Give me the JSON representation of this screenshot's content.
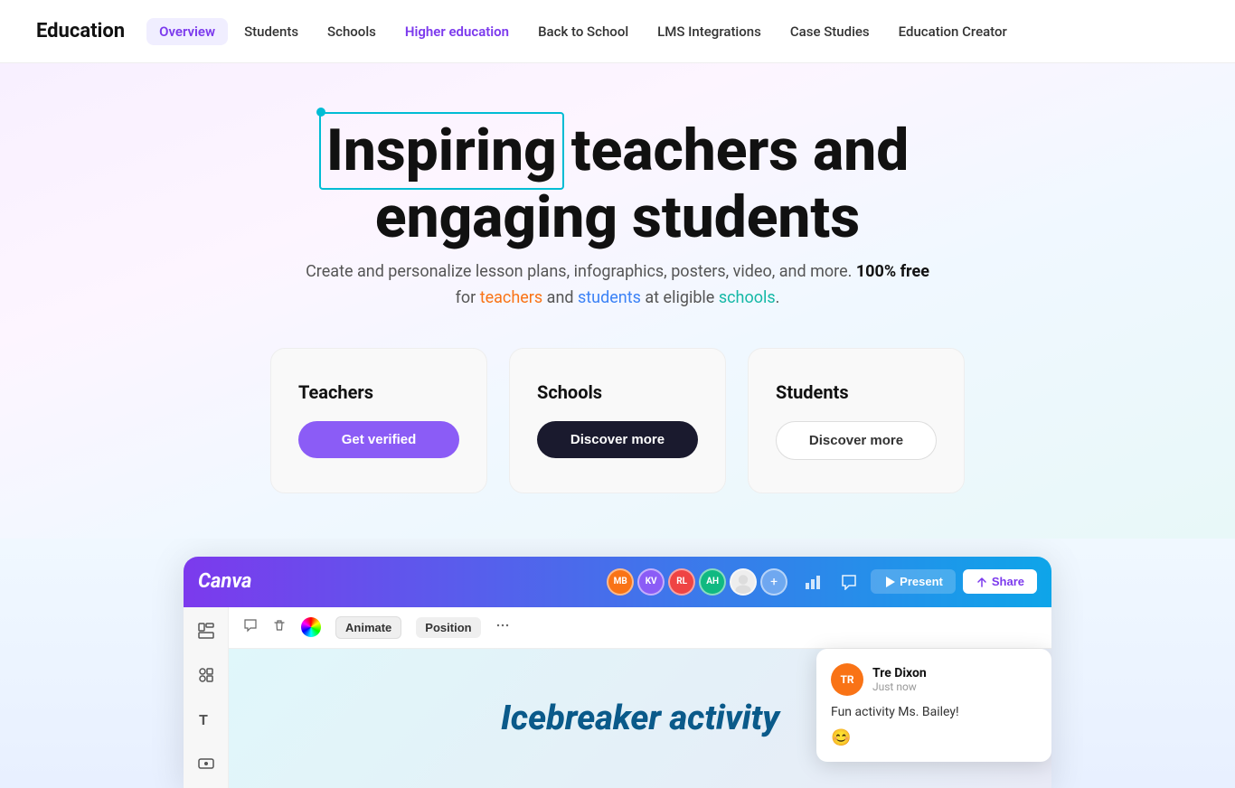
{
  "nav": {
    "brand": "Education",
    "links": [
      {
        "label": "Overview",
        "active": true
      },
      {
        "label": "Students",
        "active": false
      },
      {
        "label": "Schools",
        "active": false
      },
      {
        "label": "Higher education",
        "active": false,
        "highlight": true
      },
      {
        "label": "Back to School",
        "active": false
      },
      {
        "label": "LMS Integrations",
        "active": false
      },
      {
        "label": "Case Studies",
        "active": false
      },
      {
        "label": "Education Creator",
        "active": false
      }
    ]
  },
  "hero": {
    "title_part1": "Inspiring",
    "title_part2": " teachers and",
    "title_line2": "engaging students",
    "subtitle": "Create and personalize lesson plans, infographics, posters, video, and more.",
    "subtitle_free": "100% free",
    "subtitle_end": "for teachers and students at eligible schools."
  },
  "cards": [
    {
      "title": "Teachers",
      "button_label": "Get verified",
      "button_type": "purple"
    },
    {
      "title": "Schools",
      "button_label": "Discover more",
      "button_type": "dark"
    },
    {
      "title": "Students",
      "button_label": "Discover more",
      "button_type": "outline"
    }
  ],
  "canva_mockup": {
    "logo": "Canva",
    "avatars": [
      {
        "initials": "MB",
        "color": "#f97316"
      },
      {
        "initials": "KV",
        "color": "#8b5cf6"
      },
      {
        "initials": "RL",
        "color": "#ef4444"
      },
      {
        "initials": "AH",
        "color": "#10b981"
      }
    ],
    "present_label": "Present",
    "share_label": "Share",
    "animate_label": "Animate",
    "position_label": "Position",
    "canvas_text": "Icebreaker activity",
    "comment": {
      "initials": "TR",
      "name": "Tre Dixon",
      "time": "Just now",
      "text": "Fun activity Ms. Bailey!",
      "emoji": "😊"
    }
  }
}
